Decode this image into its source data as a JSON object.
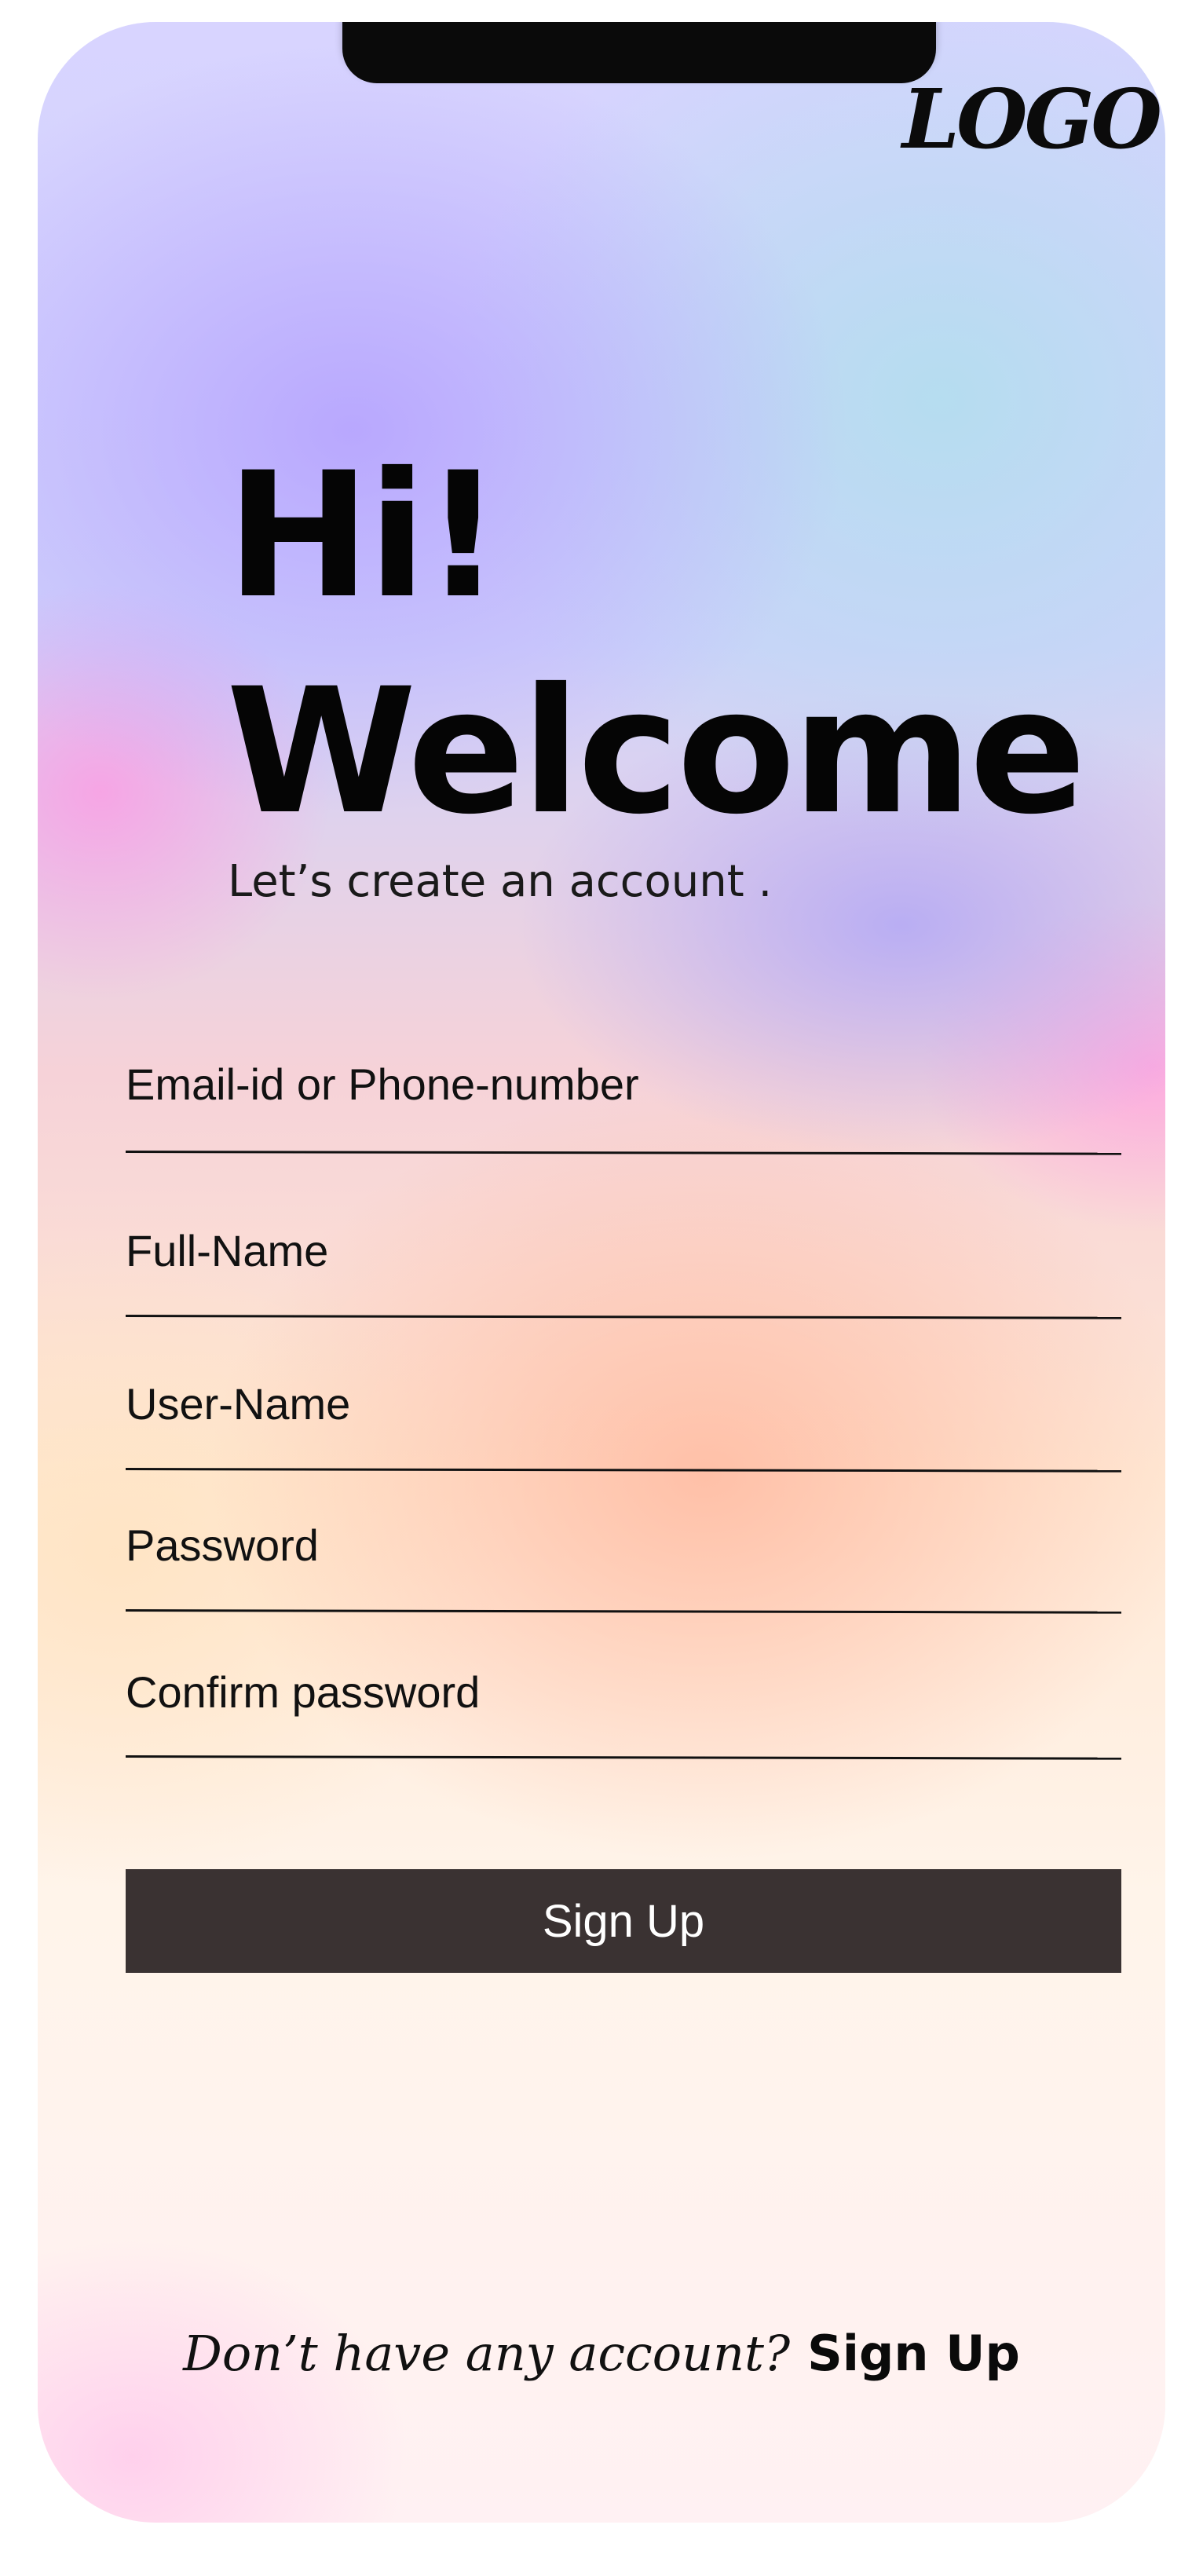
{
  "brand": {
    "logo_text": "LOGO"
  },
  "hero": {
    "line1": "Hi!",
    "line2": "Welcome",
    "subtitle": "Let’s create an account ."
  },
  "form": {
    "fields": [
      {
        "label": "Email-id or Phone-number",
        "value": ""
      },
      {
        "label": "Full-Name",
        "value": ""
      },
      {
        "label": "User-Name",
        "value": ""
      },
      {
        "label": "Password",
        "value": ""
      },
      {
        "label": "Confirm password",
        "value": ""
      }
    ],
    "submit_label": "Sign Up"
  },
  "footer": {
    "question": "Don’t have any account?",
    "link_label": "Sign Up"
  },
  "colors": {
    "button_bg": "#3a3232",
    "button_text": "#ffffff",
    "text": "#050505"
  }
}
